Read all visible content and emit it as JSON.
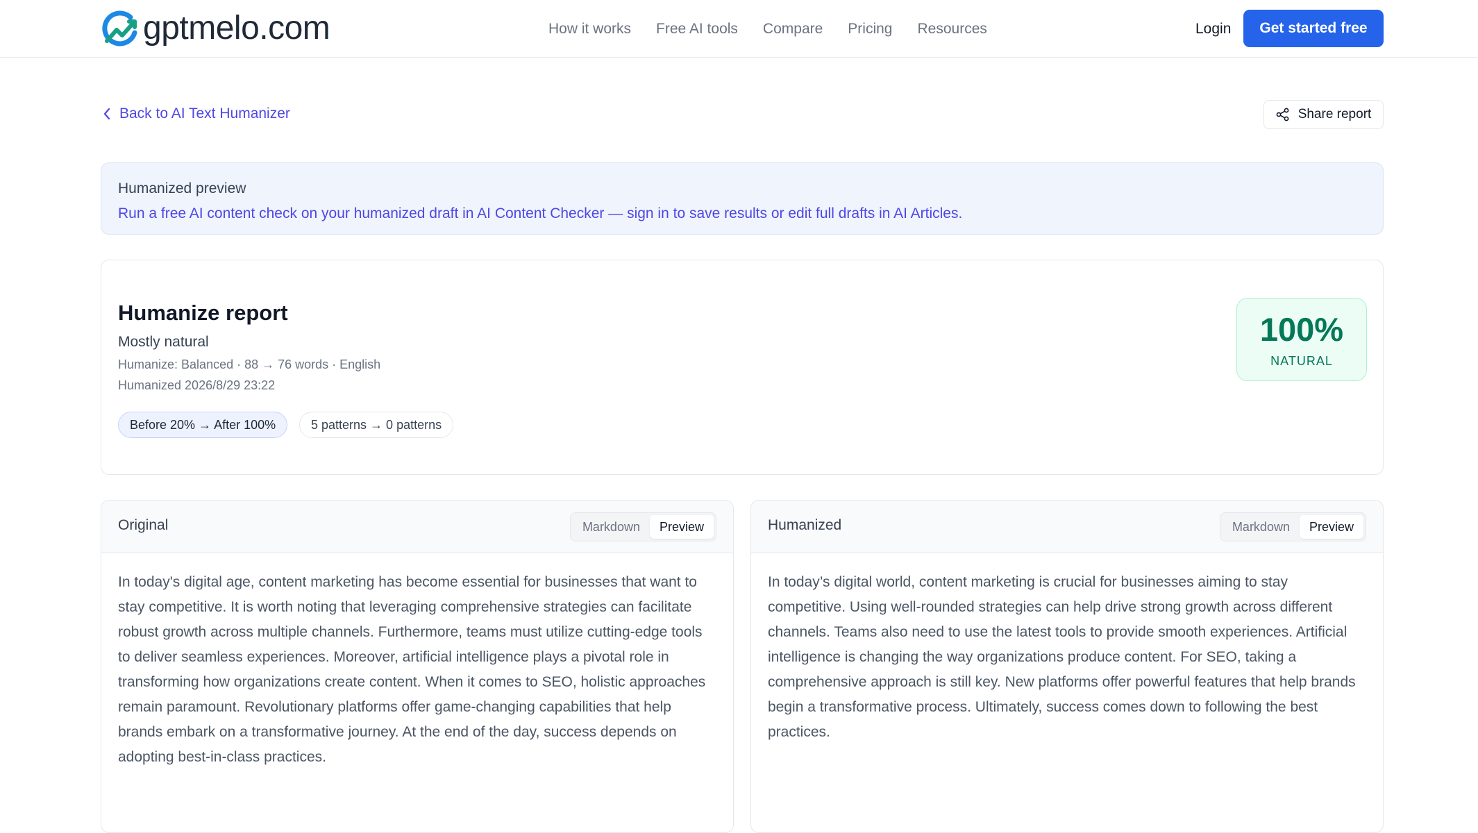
{
  "brand": {
    "name": "gptmelo.com",
    "accent": "#2563eb"
  },
  "nav": {
    "links": [
      "How it works",
      "Free AI tools",
      "Compare",
      "Pricing",
      "Resources"
    ],
    "login": "Login",
    "cta": "Get started free"
  },
  "toolbar": {
    "back_label": "Back to AI Text Humanizer",
    "share_label": "Share report"
  },
  "notice": {
    "title": "Humanized preview",
    "body": "Run a free AI content check on your humanized draft in AI Content Checker — sign in to save results or edit full drafts in AI Articles."
  },
  "report": {
    "title": "Humanize report",
    "verdict": "Mostly natural",
    "meta": "Humanize: Balanced · 88 → 76 words · English",
    "timestamp": "Humanized 2026/8/29 23:22",
    "chips": [
      "Before 20% → After 100%",
      "5 patterns → 0 patterns"
    ],
    "score_value": "100%",
    "score_label": "NATURAL",
    "score_color": "#047857"
  },
  "panels": {
    "original": {
      "title": "Original",
      "modes": [
        "Markdown",
        "Preview"
      ],
      "active_mode": "Preview",
      "text": "In today's digital age, content marketing has become essential for businesses that want to stay competitive. It is worth noting that leveraging comprehensive strategies can facilitate robust growth across multiple channels. Furthermore, teams must utilize cutting-edge tools to deliver seamless experiences. Moreover, artificial intelligence plays a pivotal role in transforming how organizations create content. When it comes to SEO, holistic approaches remain paramount. Revolutionary platforms offer game-changing capabilities that help brands embark on a transformative journey. At the end of the day, success depends on adopting best-in-class practices."
    },
    "humanized": {
      "title": "Humanized",
      "modes": [
        "Markdown",
        "Preview"
      ],
      "active_mode": "Preview",
      "text": "In today’s digital world, content marketing is crucial for businesses aiming to stay competitive. Using well-rounded strategies can help drive strong growth across different channels. Teams also need to use the latest tools to provide smooth experiences. Artificial intelligence is changing the way organizations produce content. For SEO, taking a comprehensive approach is still key. New platforms offer powerful features that help brands begin a transformative process. Ultimately, success comes down to following the best practices."
    }
  }
}
